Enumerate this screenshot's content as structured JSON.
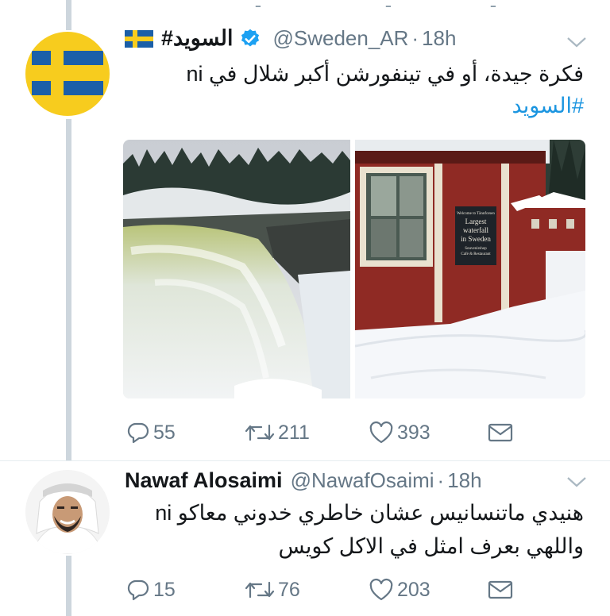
{
  "tweets": [
    {
      "display_name": "#السويد",
      "handle": "@Sweden_AR",
      "separator": "·",
      "time": "18h",
      "text_lines": [
        "فكرة جيدة، أو في تينفورشن أكبر شلال في ni"
      ],
      "hashtag": "#السويد",
      "media": {
        "sign_lines": [
          "Welcome to Tännforsen",
          "Largest",
          "waterfall",
          "in Sweden",
          "Souvenirshop",
          "Café & Restaurant"
        ]
      },
      "actions": {
        "replies": "55",
        "retweets": "211",
        "likes": "393"
      },
      "colors": {
        "flag_blue": "#1b5fa8",
        "flag_yellow": "#f7cc1e"
      }
    },
    {
      "display_name": "Nawaf Alosaimi",
      "handle": "@NawafOsaimi",
      "separator": "·",
      "time": "18h",
      "text_lines": [
        "هنيدي ماتنسانيس عشان خاطري خدوني معاكو ni",
        "واللهي بعرف امثل في الاكل كويس"
      ],
      "actions": {
        "replies": "15",
        "retweets": "76",
        "likes": "203"
      }
    }
  ],
  "colors": {
    "accent": "#1b95e0",
    "muted": "#657786",
    "thread": "#cdd6dd"
  },
  "icons": [
    "reply-icon",
    "retweet-icon",
    "like-icon",
    "message-icon",
    "verified-icon",
    "sweden-flag-icon",
    "chevron-down-icon"
  ]
}
